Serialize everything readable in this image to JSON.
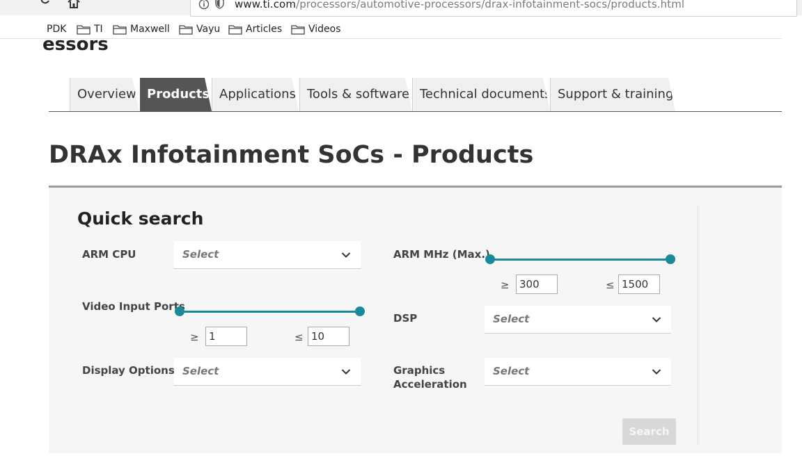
{
  "browser": {
    "url_host": "www.ti.com",
    "url_path": "/processors/automotive-processors/drax-infotainment-socs/products.html",
    "bookmarks": [
      {
        "label": "PDK",
        "folder": false
      },
      {
        "label": "TI",
        "folder": true
      },
      {
        "label": "Maxwell",
        "folder": true
      },
      {
        "label": "Vayu",
        "folder": true
      },
      {
        "label": "Articles",
        "folder": true
      },
      {
        "label": "Videos",
        "folder": true
      }
    ]
  },
  "header": {
    "partial_heading": "essors"
  },
  "tabs": [
    {
      "label": "Overview",
      "active": false
    },
    {
      "label": "Products",
      "active": true
    },
    {
      "label": "Applications",
      "active": false
    },
    {
      "label": "Tools & software",
      "active": false
    },
    {
      "label": "Technical documents",
      "active": false
    },
    {
      "label": "Support & training",
      "active": false
    }
  ],
  "main": {
    "title": "DRAx Infotainment SoCs - Products"
  },
  "quick_search": {
    "title": "Quick search",
    "arm_cpu": {
      "label": "ARM CPU",
      "placeholder": "Select"
    },
    "arm_mhz": {
      "label": "ARM MHz (Max.)",
      "min": "300",
      "max": "1500",
      "ge": "≥",
      "le": "≤"
    },
    "video_input_ports": {
      "label": "Video Input Ports",
      "min": "1",
      "max": "10",
      "ge": "≥",
      "le": "≤"
    },
    "dsp": {
      "label": "DSP",
      "placeholder": "Select"
    },
    "display_options": {
      "label": "Display Options",
      "placeholder": "Select"
    },
    "graphics_acceleration": {
      "label_line1": "Graphics",
      "label_line2": "Acceleration",
      "placeholder": "Select"
    },
    "search_label": "Search"
  },
  "colors": {
    "accent": "#1a8a98",
    "active_tab": "#555555",
    "panel_bg": "#f6f6f6"
  }
}
